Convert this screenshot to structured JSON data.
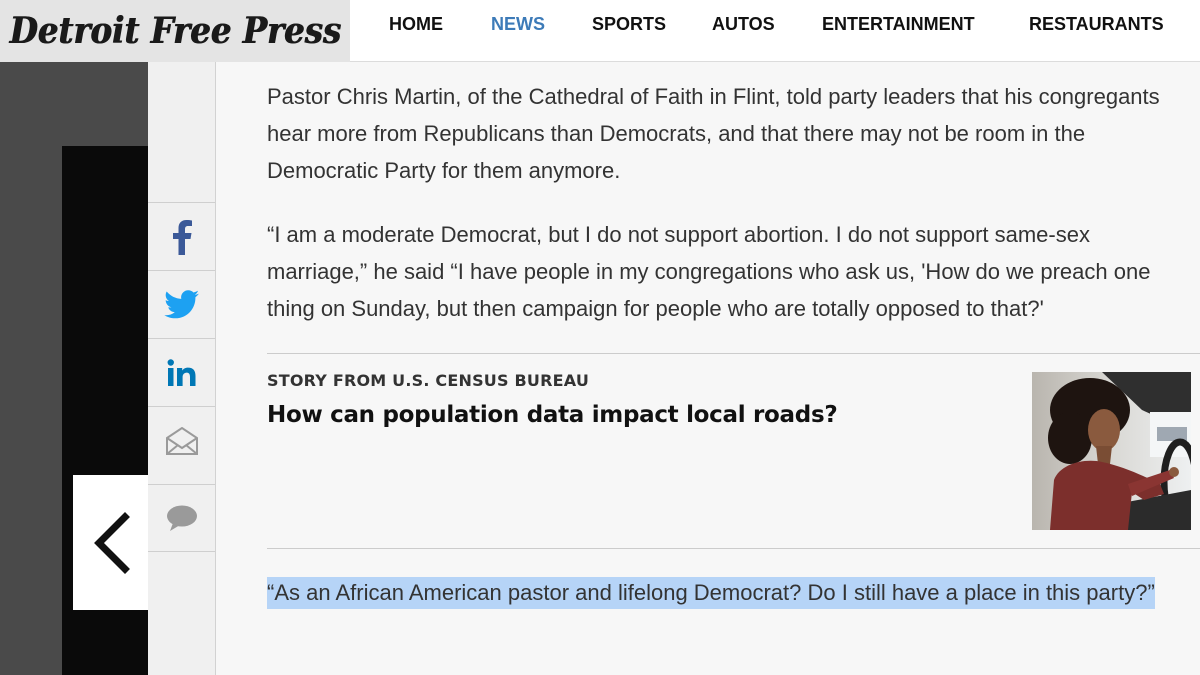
{
  "header": {
    "logo_text": "Detroit Free Press",
    "nav": [
      "HOME",
      "NEWS",
      "SPORTS",
      "AUTOS",
      "ENTERTAINMENT",
      "RESTAURANTS"
    ],
    "active_nav": "NEWS"
  },
  "share": {
    "icons": [
      "facebook-icon",
      "twitter-icon",
      "linkedin-icon",
      "email-icon",
      "comment-icon"
    ],
    "colors": {
      "facebook": "#3b5998",
      "twitter": "#1da1f2",
      "linkedin": "#0077b5",
      "muted": "#9a9a9a"
    }
  },
  "gallery": {
    "prev_icon": "chevron-left-icon"
  },
  "article": {
    "paragraphs": [
      "Pastor Chris Martin, of the Cathedral of Faith in Flint, told party leaders that his congregants hear more from Republicans than Democrats, and that there may not be room in the Democratic Party for them anymore.",
      "“I am a moderate Democrat, but I do not support abortion. I do not support same-sex marriage,” he said “I have people in my congregations who ask us, 'How do we preach one thing on Sunday, but then campaign for people who are totally opposed to that?'"
    ],
    "promo": {
      "label": "STORY FROM U.S. CENSUS BUREAU",
      "headline": "How can population data impact local roads?"
    },
    "highlighted_quote": "“As an African American pastor and lifelong Democrat? Do I still have a place in this party?”",
    "highlight_color": "#b6d4f7"
  }
}
